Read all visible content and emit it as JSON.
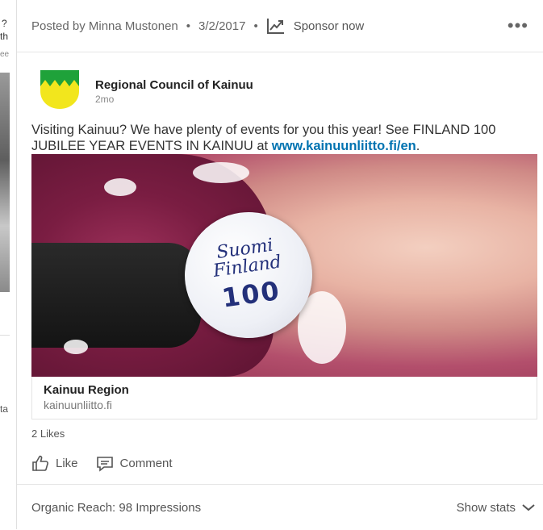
{
  "left_fragments": {
    "q": "?",
    "th": "th",
    "ee": "ee",
    "ta": "ta"
  },
  "header": {
    "posted_by": "Posted by Minna Mustonen",
    "date": "3/2/2017",
    "sponsor_label": "Sponsor now",
    "more": "•••"
  },
  "author": {
    "name": "Regional Council of Kainuu",
    "time": "2mo",
    "logo_colors": {
      "top": "#1fa23a",
      "bottom": "#f2e61d"
    }
  },
  "post": {
    "text": "Visiting Kainuu? We have plenty of events for you this year! See FINLAND 100 JUBILEE YEAR EVENTS IN KAINUU at ",
    "link": "www.kainuunliitto.fi/en",
    "end": "."
  },
  "media": {
    "pin_line1": "Suomi",
    "pin_line2": "Finland",
    "pin_line3": "100"
  },
  "link_preview": {
    "title": "Kainuu Region",
    "domain": "kainuunliitto.fi"
  },
  "likes": "2 Likes",
  "actions": {
    "like": "Like",
    "comment": "Comment"
  },
  "stats": {
    "organic_reach": "Organic Reach: 98 Impressions",
    "show_stats": "Show stats"
  },
  "colors": {
    "link": "#0073b1",
    "text": "#333333",
    "muted": "#666666"
  }
}
